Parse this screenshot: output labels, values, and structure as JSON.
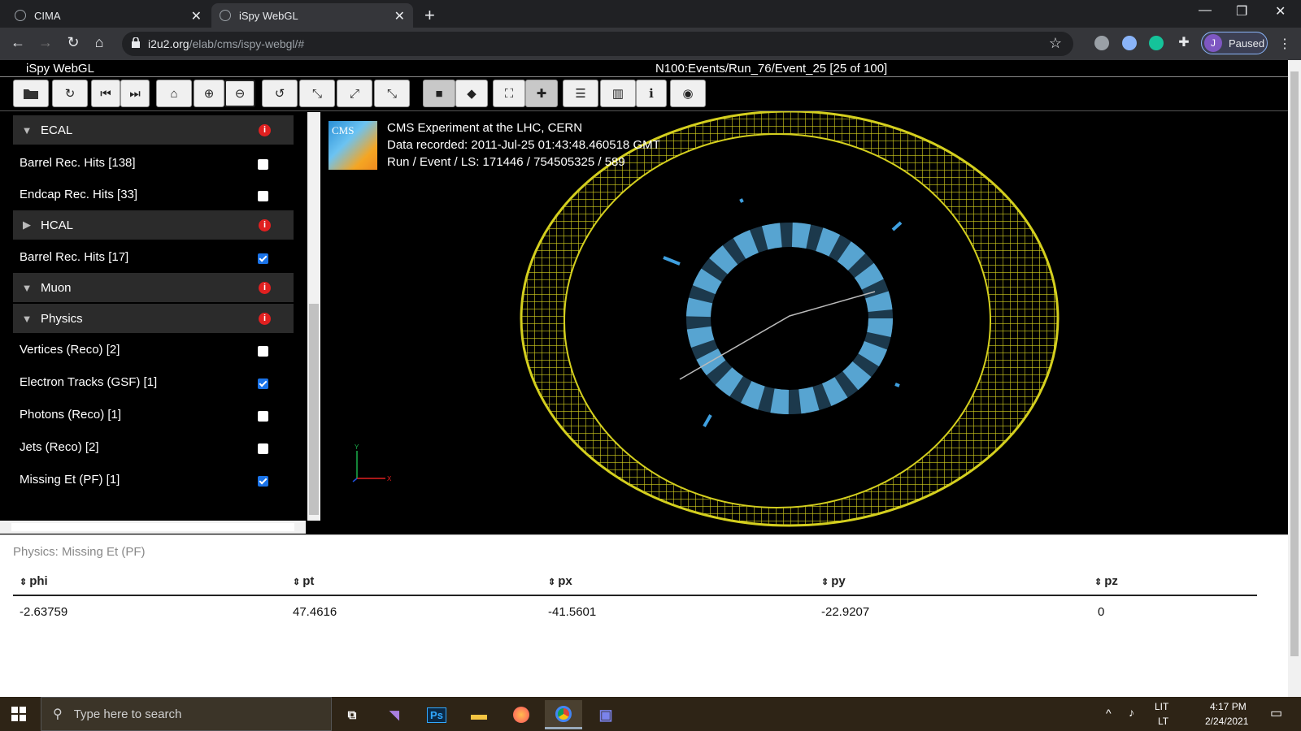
{
  "browser": {
    "tabs": [
      {
        "label": "CIMA"
      },
      {
        "label": "iSpy WebGL"
      }
    ],
    "url_host": "i2u2.org",
    "url_path": "/elab/cms/ispy-webgl/#",
    "profile_initial": "J",
    "profile_status": "Paused"
  },
  "app": {
    "title": "iSpy WebGL",
    "event": "N100:Events/Run_76/Event_25 [25 of 100]"
  },
  "tree": {
    "categories": [
      {
        "label": "ECAL",
        "expanded": true
      },
      {
        "label": "HCAL",
        "expanded": false
      },
      {
        "label": "Muon",
        "expanded": true
      },
      {
        "label": "Physics",
        "expanded": true
      }
    ],
    "items": [
      {
        "label": "Barrel Rec. Hits [138]",
        "checked": false
      },
      {
        "label": "Endcap Rec. Hits [33]",
        "checked": false
      },
      {
        "label": "Barrel Rec. Hits [17]",
        "checked": true
      },
      {
        "label": "Vertices (Reco) [2]",
        "checked": false
      },
      {
        "label": "Electron Tracks (GSF) [1]",
        "checked": true
      },
      {
        "label": "Photons (Reco) [1]",
        "checked": false
      },
      {
        "label": "Jets (Reco) [2]",
        "checked": false
      },
      {
        "label": "Missing Et (PF) [1]",
        "checked": true
      }
    ]
  },
  "view": {
    "logo_text": "CMS",
    "line1": "CMS Experiment at the LHC, CERN",
    "line2": "Data recorded: 2011-Jul-25 01:43:48.460518 GMT",
    "line3": "Run / Event / LS: 171446 / 754505325 / 589",
    "axis_y": "Y",
    "axis_x": "X",
    "colors": {
      "yoke": "#d4cf1e",
      "tracker": "#6cc3f2"
    }
  },
  "table": {
    "title": "Physics: Missing Et (PF)",
    "columns": [
      "phi",
      "pt",
      "px",
      "py",
      "pz"
    ],
    "rows": [
      [
        "-2.63759",
        "47.4616",
        "-41.5601",
        "-22.9207",
        "0"
      ]
    ]
  },
  "taskbar": {
    "search_placeholder": "Type here to search",
    "lang_top": "LIT",
    "lang_bottom": "LT",
    "time": "4:17 PM",
    "date": "2/24/2021"
  }
}
